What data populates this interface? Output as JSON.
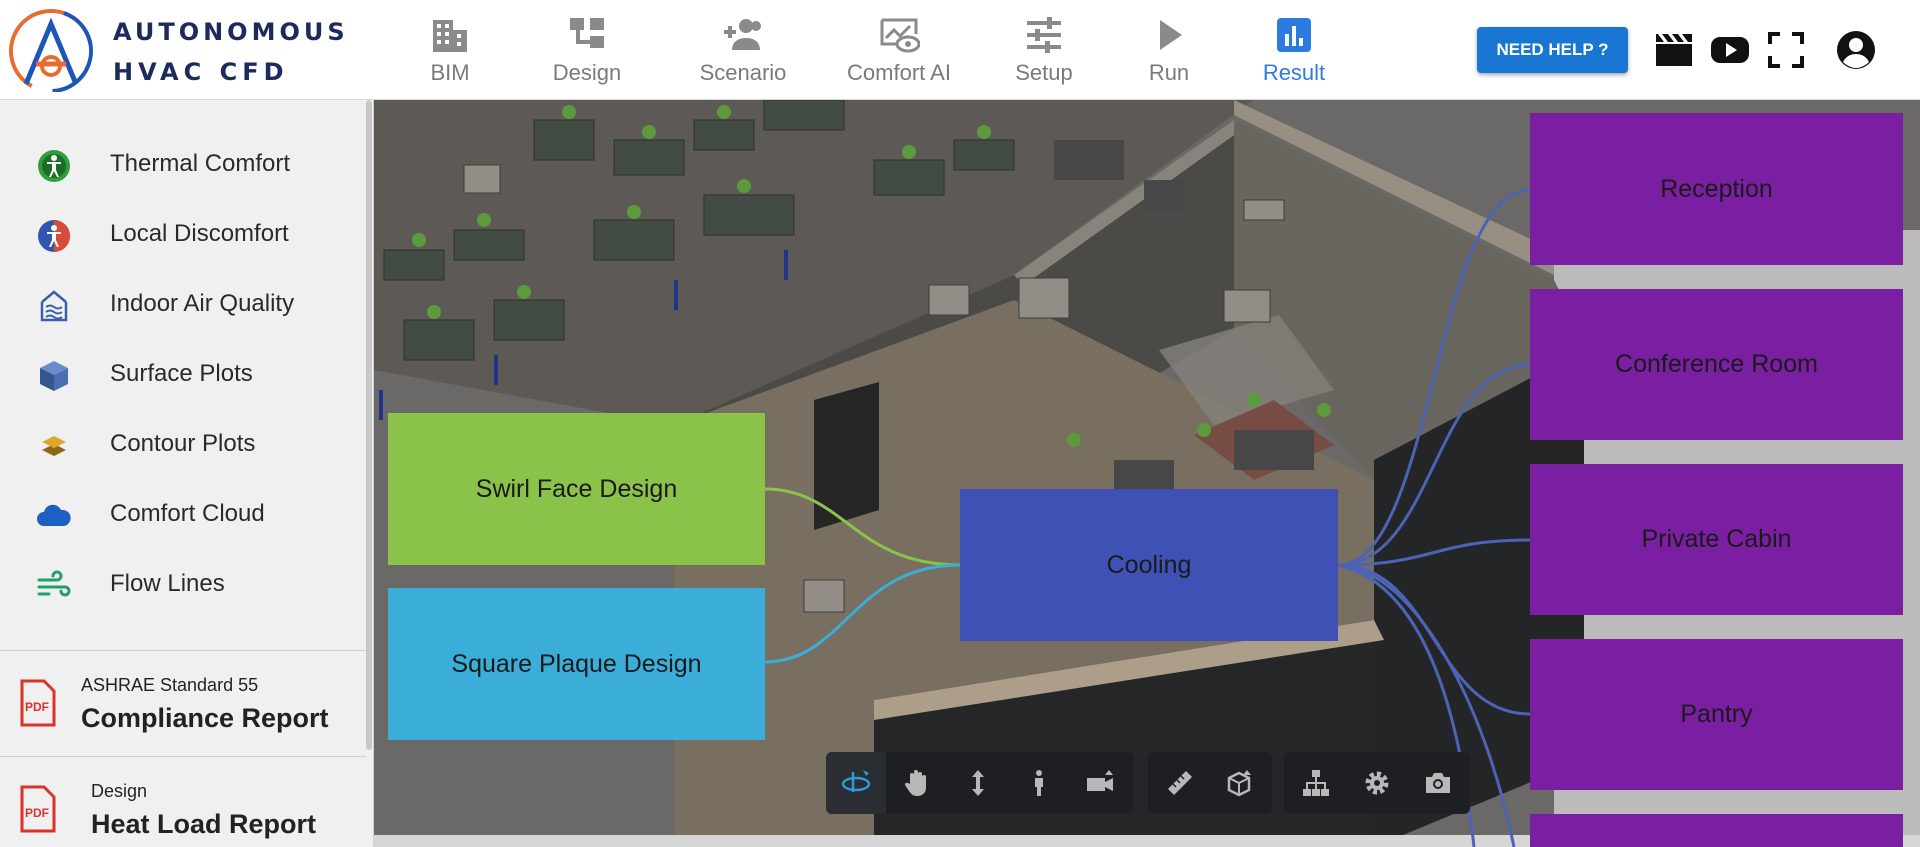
{
  "brand": {
    "line1": "AUTONOMOUS",
    "line2": "HVAC CFD"
  },
  "nav": [
    {
      "label": "BIM",
      "icon": "building-icon"
    },
    {
      "label": "Design",
      "icon": "design-icon"
    },
    {
      "label": "Scenario",
      "icon": "people-add-icon"
    },
    {
      "label": "Comfort AI",
      "icon": "eye-chart-icon"
    },
    {
      "label": "Setup",
      "icon": "sliders-icon"
    },
    {
      "label": "Run",
      "icon": "play-icon"
    },
    {
      "label": "Result",
      "icon": "bar-chart-icon",
      "active": true
    }
  ],
  "header": {
    "help_label": "NEED HELP ?"
  },
  "sidebar": {
    "items": [
      {
        "label": "Thermal Comfort",
        "icon": "person-circle-green-icon"
      },
      {
        "label": "Local Discomfort",
        "icon": "accessibility-icon"
      },
      {
        "label": "Indoor Air Quality",
        "icon": "air-quality-icon"
      },
      {
        "label": "Surface Plots",
        "icon": "cube-icon"
      },
      {
        "label": "Contour Plots",
        "icon": "layers-icon"
      },
      {
        "label": "Comfort Cloud",
        "icon": "cloud-icon"
      },
      {
        "label": "Flow Lines",
        "icon": "flow-lines-icon"
      }
    ],
    "reports": [
      {
        "sub": "ASHRAE Standard 55",
        "title": "Compliance Report",
        "icon": "pdf-icon"
      },
      {
        "sub": "Design",
        "title": "Heat Load Report",
        "icon": "pdf-icon"
      }
    ]
  },
  "diagram": {
    "designs": [
      {
        "label": "Swirl Face Design",
        "color": "#8bc34a"
      },
      {
        "label": "Square Plaque Design",
        "color": "#3aaed8"
      }
    ],
    "mode": {
      "label": "Cooling",
      "color": "#3f51b5"
    },
    "rooms": [
      {
        "label": "Reception",
        "color": "#7b1fa2"
      },
      {
        "label": "Conference Room",
        "color": "#7b1fa2"
      },
      {
        "label": "Private Cabin",
        "color": "#7b1fa2"
      },
      {
        "label": "Pantry",
        "color": "#7b1fa2"
      }
    ]
  },
  "toolbar": {
    "groups": [
      [
        "orbit-icon",
        "pan-hand-icon",
        "vertical-move-icon",
        "walk-person-icon",
        "camera-icon"
      ],
      [
        "ruler-icon",
        "section-box-icon"
      ],
      [
        "hierarchy-icon",
        "settings-gear-icon",
        "screenshot-camera-icon"
      ]
    ]
  }
}
